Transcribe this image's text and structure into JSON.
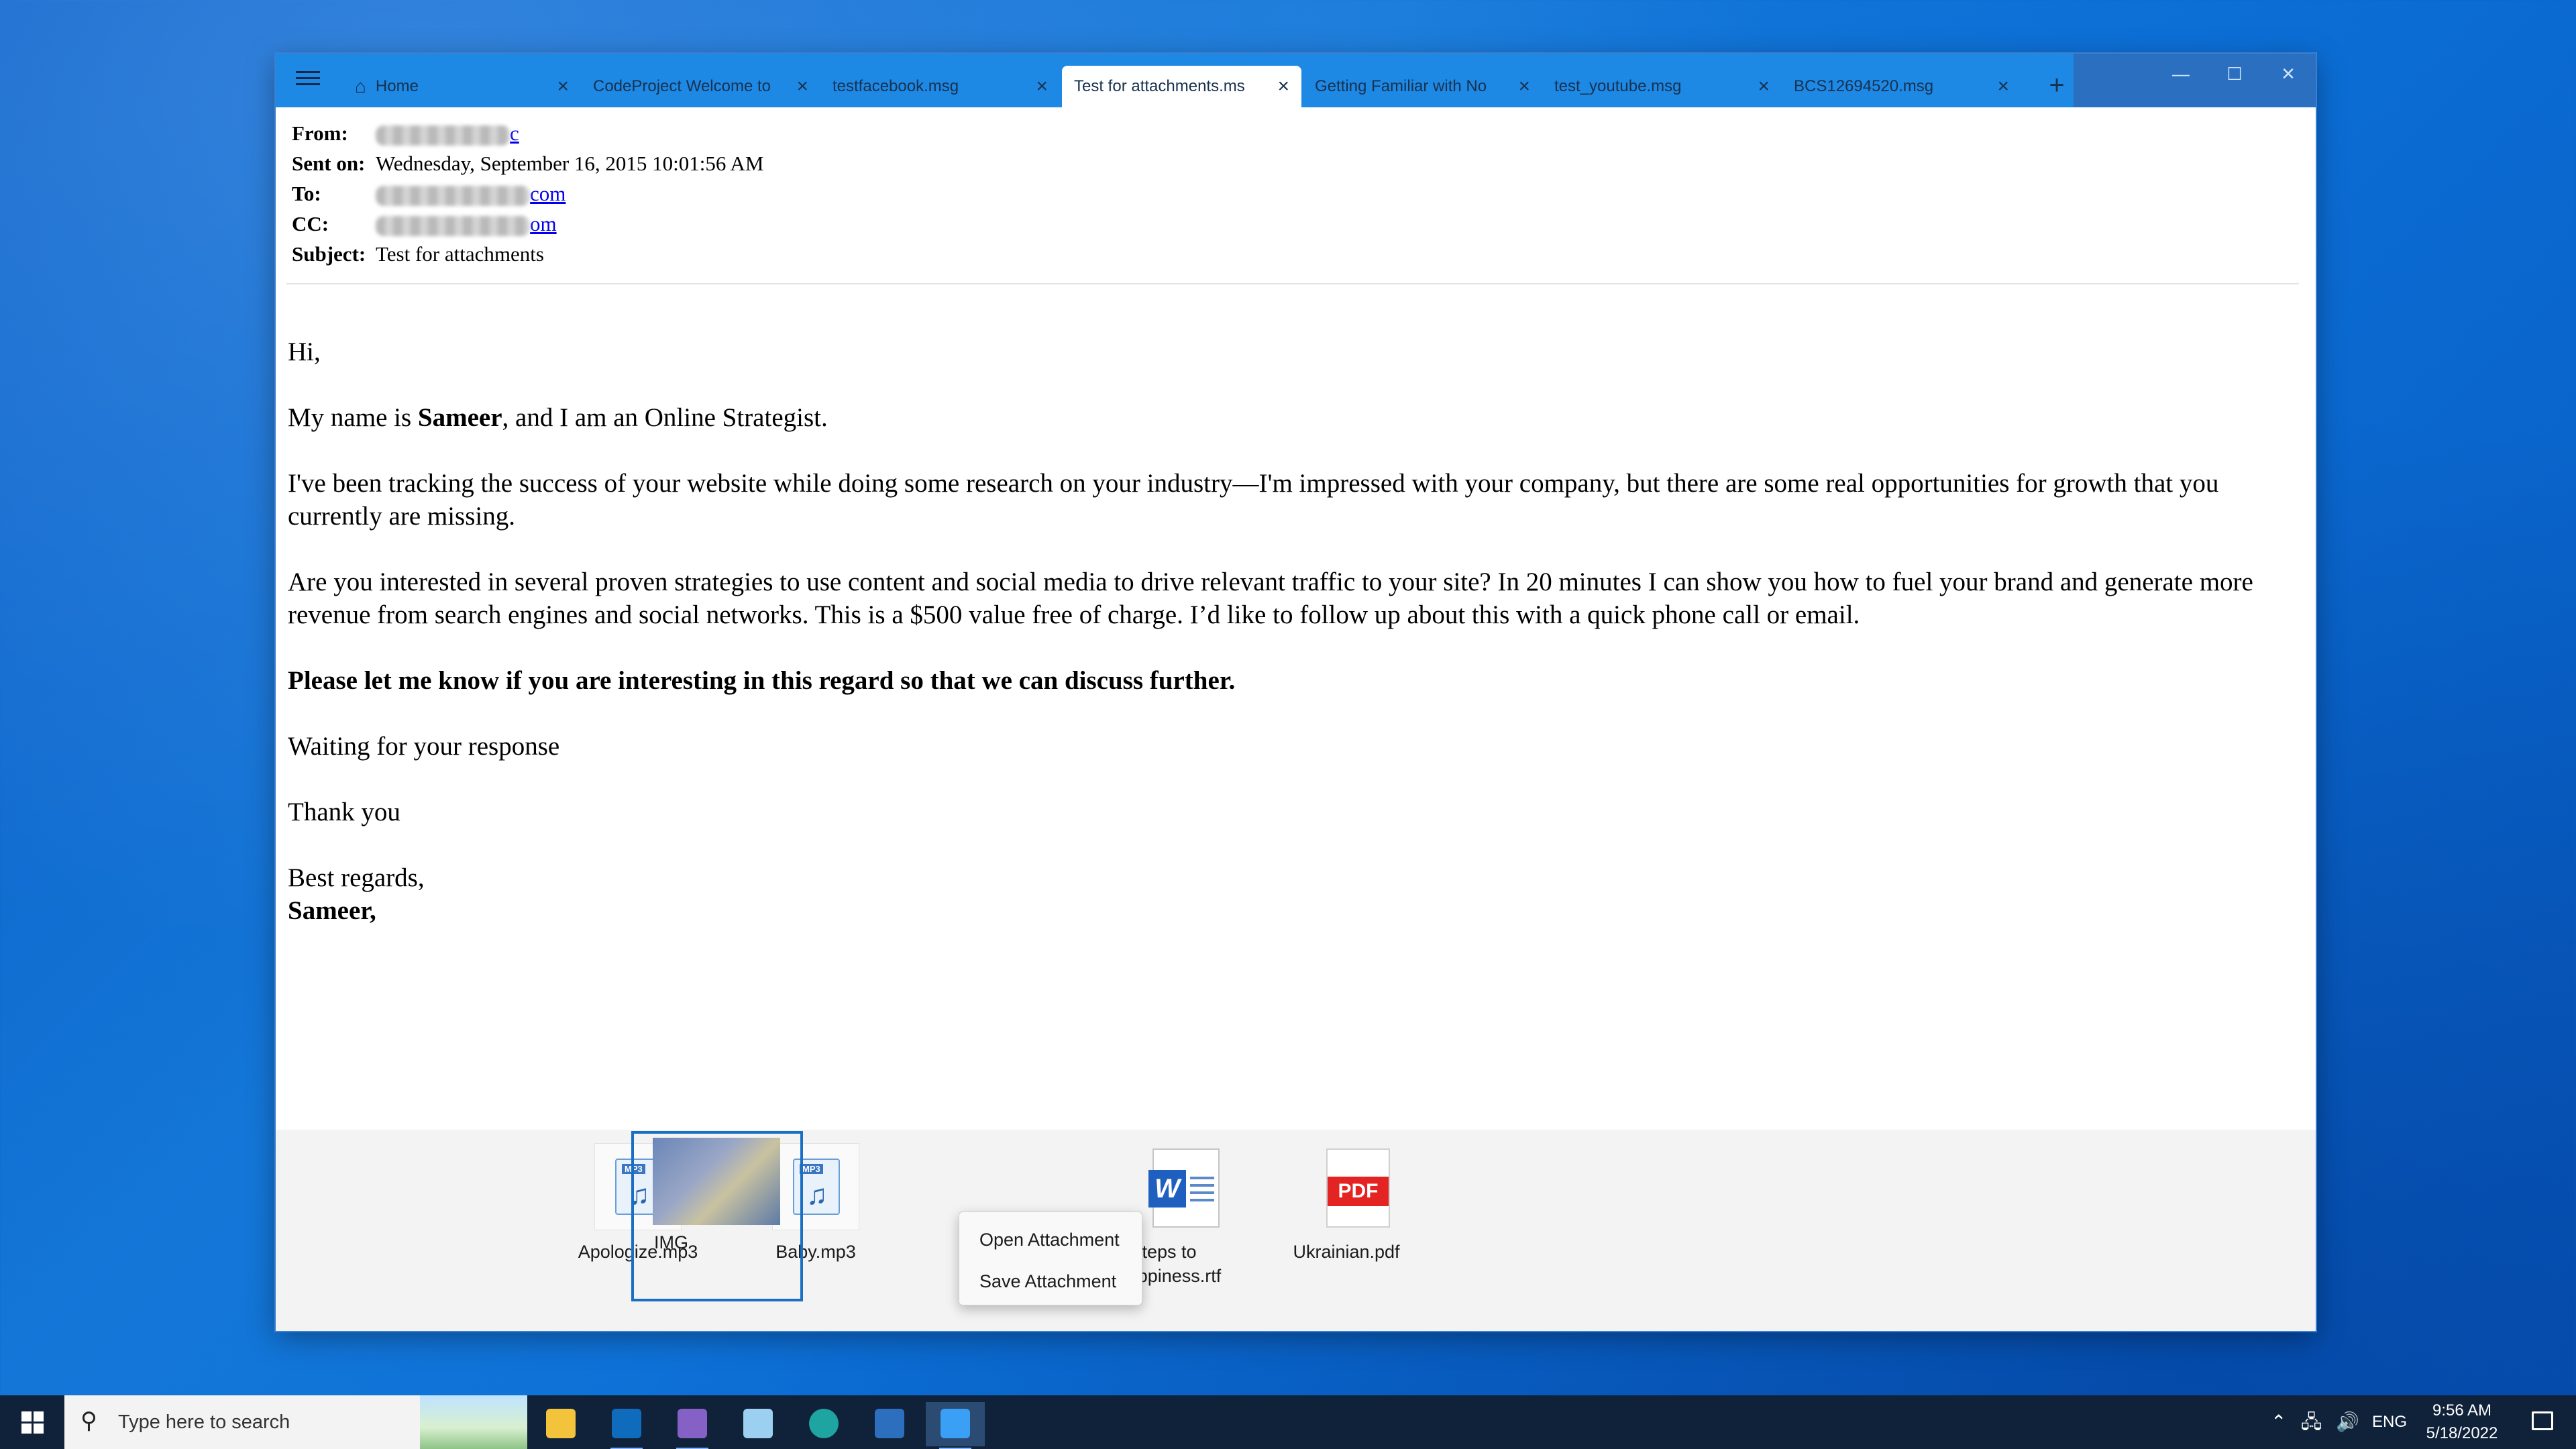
{
  "window": {
    "tabs": [
      {
        "label": "Home",
        "icon": "home-icon"
      },
      {
        "label": "CodeProject  Welcome to"
      },
      {
        "label": "testfacebook.msg"
      },
      {
        "label": "Test for attachments.ms"
      },
      {
        "label": "Getting Familiar with No"
      },
      {
        "label": "test_youtube.msg"
      },
      {
        "label": "BCS12694520.msg"
      }
    ],
    "new_tab": "+",
    "controls": {
      "minimize": "—",
      "maximize": "☐",
      "close": "✕"
    }
  },
  "message": {
    "labels": {
      "from": "From:",
      "sent": "Sent on:",
      "to": "To:",
      "cc": "CC:",
      "subject": "Subject:"
    },
    "from_tail": "c",
    "sent_on": "Wednesday, September 16, 2015 10:01:56 AM",
    "to_tail": "com",
    "cc_tail": "om",
    "subject": "Test for attachments",
    "body": {
      "greeting": "Hi,",
      "intro_before": "My name is ",
      "intro_name": "Sameer",
      "intro_after": ", and I am an Online Strategist.",
      "p2": "I've been tracking the success of your website while doing some research on your industry—I'm impressed with your company, but there are some real opportunities for growth that you currently are missing.",
      "p3": "Are you interested in several proven strategies to use content and social media to drive relevant traffic to your site? In 20 minutes I can show you how to fuel your brand and generate more revenue from search engines and social networks. This is a $500 value free of charge. I’d like to follow up about this with a quick phone call or email.",
      "p4": "Please let me know if you are interesting in this regard so that we can discuss further.",
      "p5": "Waiting for your response",
      "p6": "Thank you",
      "closing": "Best regards,",
      "signature": "Sameer,"
    }
  },
  "attachments": [
    {
      "name": "Apologize.mp3",
      "badge": "MP3"
    },
    {
      "name": "Baby.mp3",
      "badge": "MP3"
    },
    {
      "name": "IMG"
    },
    {
      "name": "teps to",
      "name2": "happiness.rtf",
      "word_letter": "W"
    },
    {
      "name": "Ukrainian.pdf",
      "badge": "PDF"
    }
  ],
  "context_menu": {
    "open": "Open Attachment",
    "save": "Save Attachment"
  },
  "taskbar": {
    "search_placeholder": "Type here to search",
    "language": "ENG",
    "time": "9:56 AM",
    "date": "5/18/2022",
    "app_colors": {
      "explorer": "#f3c33c",
      "outlook": "#0f6cbd",
      "visual_studio": "#8661c5",
      "notepad": "#9bd0f0",
      "edge": "#1fa5a1",
      "photos": "#2d6fbf",
      "mail_viewer": "#3aa0f5"
    }
  }
}
